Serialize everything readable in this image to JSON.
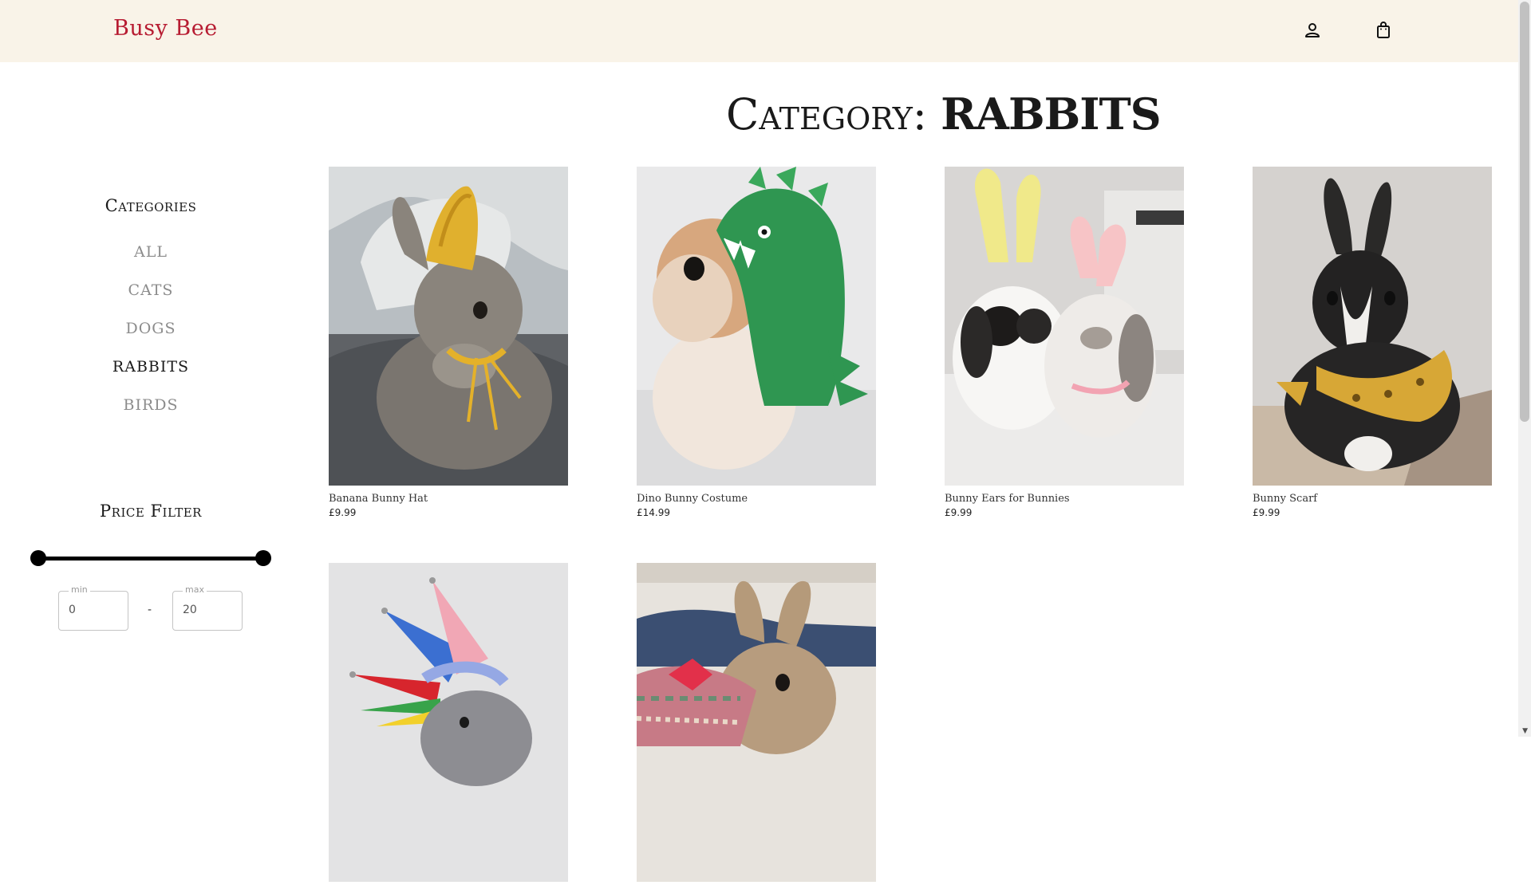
{
  "header": {
    "brand": "Busy Bee",
    "account_icon": "person-icon",
    "cart_icon": "shopping-bag-icon"
  },
  "title": {
    "prefix": "Category:",
    "category": "RABBITS"
  },
  "sidebar": {
    "categories_heading": "Categories",
    "categories": [
      {
        "label": "ALL",
        "active": false
      },
      {
        "label": "CATS",
        "active": false
      },
      {
        "label": "DOGS",
        "active": false
      },
      {
        "label": "RABBITS",
        "active": true
      },
      {
        "label": "BIRDS",
        "active": false
      }
    ],
    "price_filter_heading": "Price Filter",
    "price_min_label": "min",
    "price_min_value": "0",
    "price_max_label": "max",
    "price_max_value": "20",
    "separator": "-"
  },
  "products": [
    {
      "name": "Banana Bunny Hat",
      "price": "£9.99"
    },
    {
      "name": "Dino Bunny Costume",
      "price": "£14.99"
    },
    {
      "name": "Bunny Ears for Bunnies",
      "price": "£9.99"
    },
    {
      "name": "Bunny Scarf",
      "price": "£9.99"
    },
    {
      "name": "",
      "price": ""
    },
    {
      "name": "",
      "price": ""
    }
  ],
  "colors": {
    "brand": "#b71c32",
    "header_bg": "#f9f3e8",
    "inactive_category": "#8c8c8c",
    "active_category": "#1a1a1a"
  }
}
